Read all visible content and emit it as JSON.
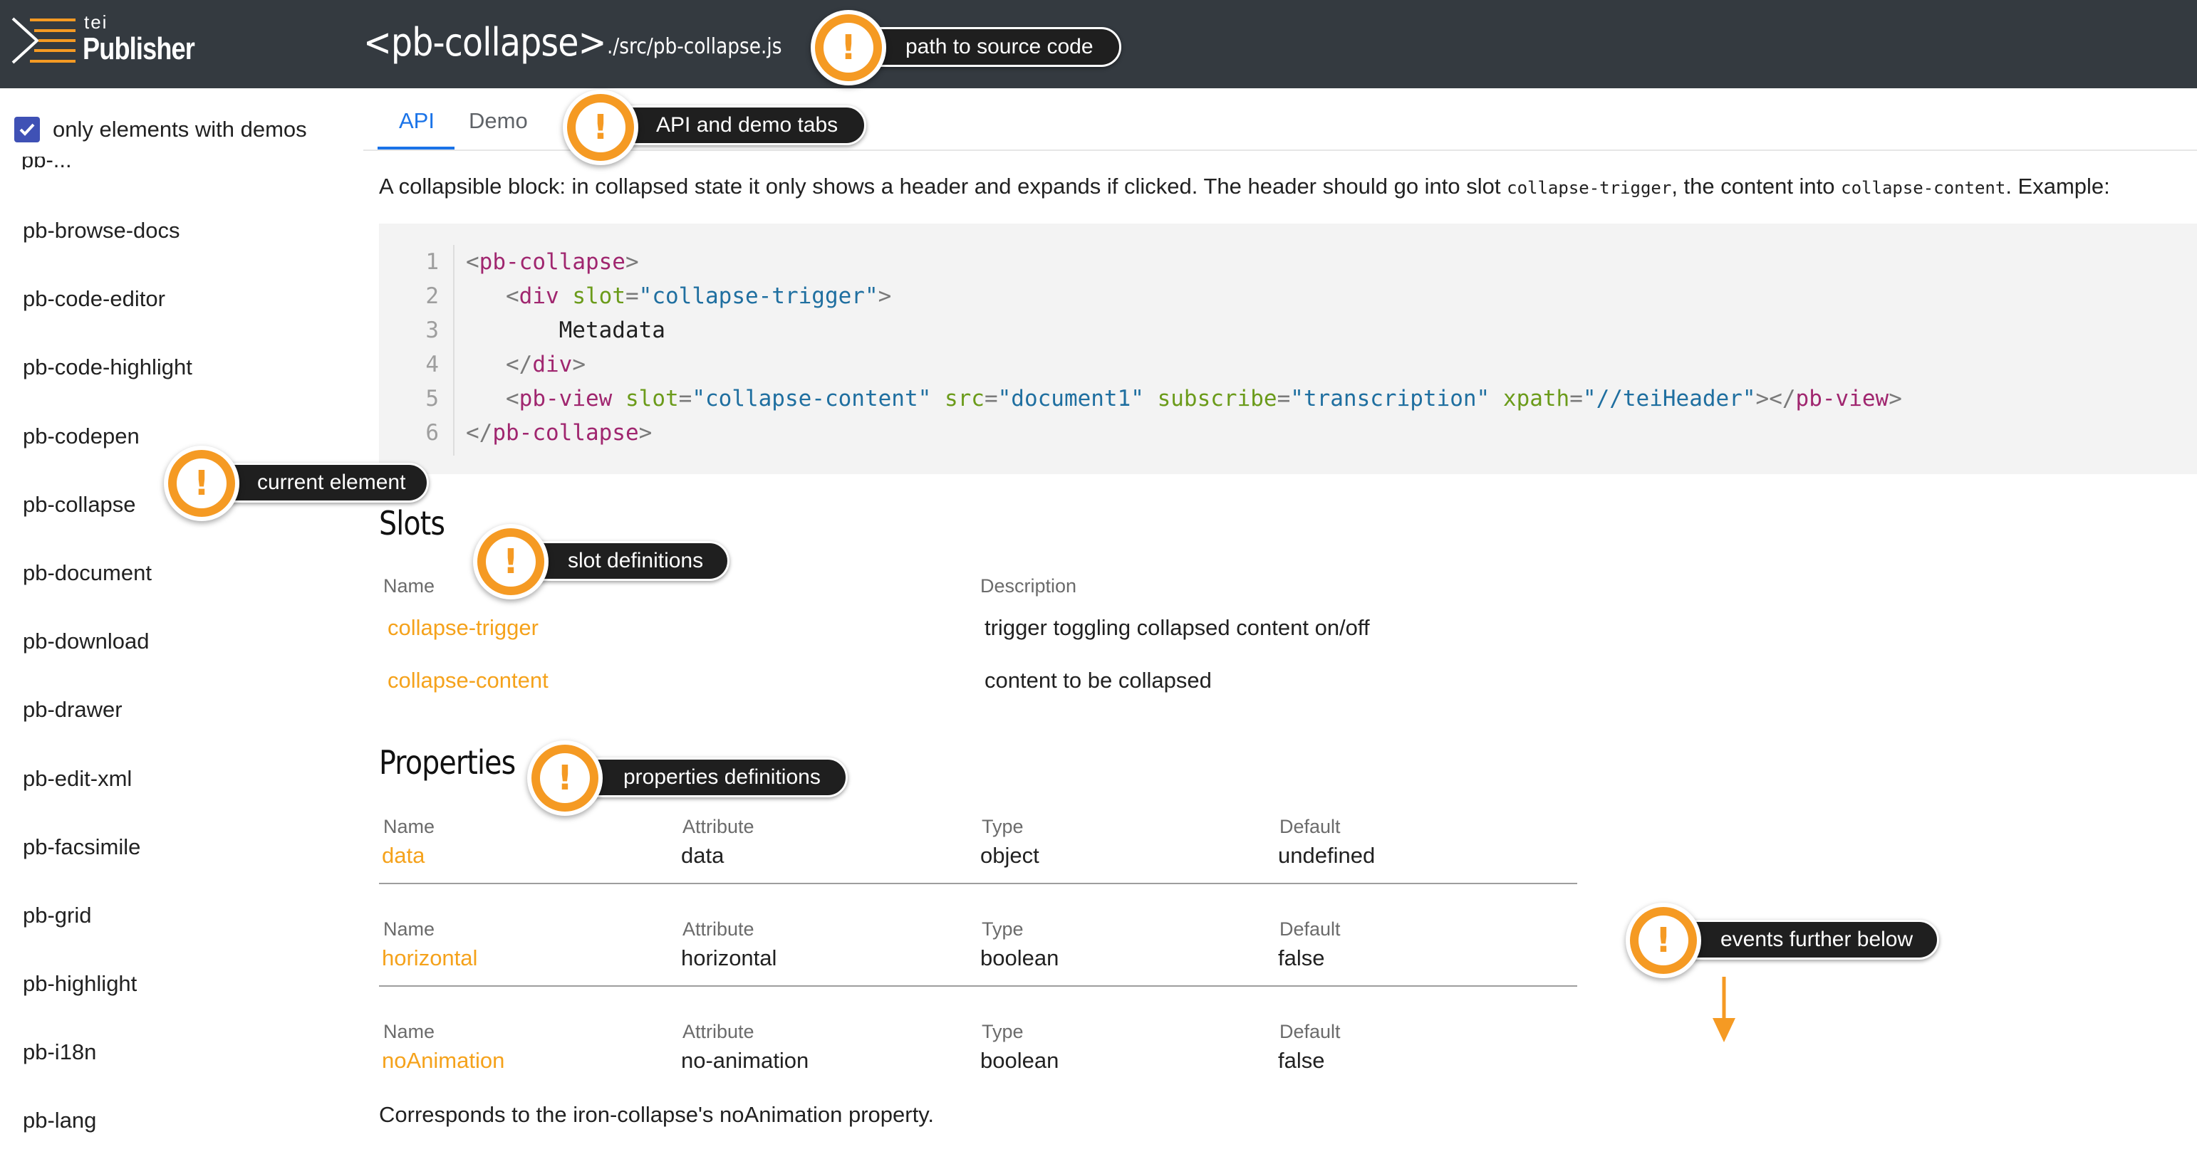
{
  "header": {
    "logo_small": "tei",
    "logo_name": "Publisher",
    "title": "<pb-collapse>",
    "source_path": "./src/pb-collapse.js"
  },
  "sidebar": {
    "filter_label": "only elements with demos",
    "filter_checked": true,
    "cut_item": "pb-...",
    "items": [
      "pb-browse-docs",
      "pb-code-editor",
      "pb-code-highlight",
      "pb-codepen",
      "pb-collapse",
      "pb-document",
      "pb-download",
      "pb-drawer",
      "pb-edit-xml",
      "pb-facsimile",
      "pb-grid",
      "pb-highlight",
      "pb-i18n",
      "pb-lang"
    ]
  },
  "tabs": [
    {
      "label": "API",
      "active": true
    },
    {
      "label": "Demo",
      "active": false
    }
  ],
  "intro": {
    "part1": "A collapsible block: in collapsed state it only shows a header and expands if clicked. The header should go into slot ",
    "code1": "collapse-trigger",
    "part2": ", the content into ",
    "code2": "collapse-content",
    "part3": ". Example:"
  },
  "code_example": {
    "line_numbers": [
      "1",
      "2",
      "3",
      "4",
      "5",
      "6"
    ]
  },
  "slots": {
    "title": "Slots",
    "col_name": "Name",
    "col_description": "Description",
    "rows": [
      {
        "name": "collapse-trigger",
        "description": "trigger toggling collapsed content on/off"
      },
      {
        "name": "collapse-content",
        "description": "content to be collapsed"
      }
    ]
  },
  "properties": {
    "title": "Properties",
    "col_name": "Name",
    "col_attribute": "Attribute",
    "col_type": "Type",
    "col_default": "Default",
    "rows": [
      {
        "name": "data",
        "attribute": "data",
        "type": "object",
        "default": "undefined"
      },
      {
        "name": "horizontal",
        "attribute": "horizontal",
        "type": "boolean",
        "default": "false"
      },
      {
        "name": "noAnimation",
        "attribute": "no-animation",
        "type": "boolean",
        "default": "false"
      }
    ],
    "note": "Corresponds to the iron-collapse's noAnimation property."
  },
  "annotations": {
    "badge_symbol": "!",
    "source": "path to source code",
    "tabs": "API and demo tabs",
    "current": "current element",
    "slots": "slot definitions",
    "properties": "properties definitions",
    "events": "events further below"
  },
  "colors": {
    "header_bg": "#343a40",
    "accent_orange": "#f59a23",
    "link_orange": "#f5a21b",
    "tab_blue": "#1a73e8",
    "checkbox": "#3f51b5"
  }
}
